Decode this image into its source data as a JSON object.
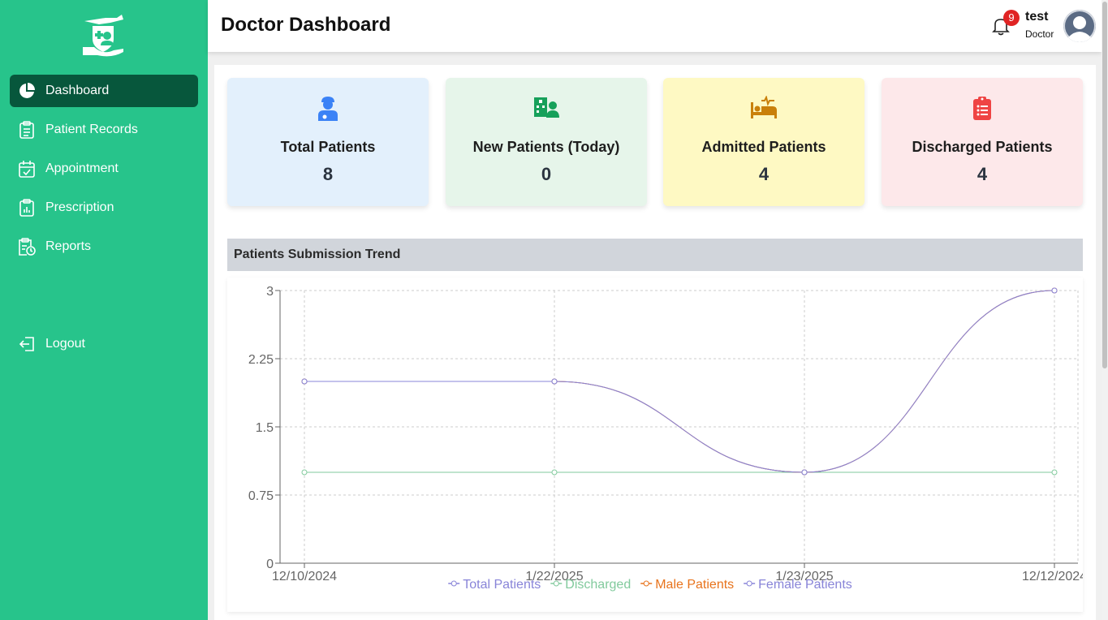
{
  "sidebar": {
    "items": [
      {
        "label": "Dashboard",
        "icon": "pie-chart-icon",
        "active": true
      },
      {
        "label": "Patient Records",
        "icon": "clipboard-list-icon",
        "active": false
      },
      {
        "label": "Appointment",
        "icon": "calendar-check-icon",
        "active": false
      },
      {
        "label": "Prescription",
        "icon": "clipboard-chart-icon",
        "active": false
      },
      {
        "label": "Reports",
        "icon": "clipboard-clock-icon",
        "active": false
      }
    ],
    "logout_label": "Logout"
  },
  "header": {
    "title": "Doctor Dashboard",
    "notification_count": "9",
    "user_name": "test",
    "user_role": "Doctor"
  },
  "cards": [
    {
      "label": "Total Patients",
      "value": "8",
      "icon": "patient-icon",
      "bg": "#e3f0fc",
      "icon_color": "#3b82f6"
    },
    {
      "label": "New Patients (Today)",
      "value": "0",
      "icon": "hospital-user-icon",
      "bg": "#e6f5ea",
      "icon_color": "#16a05a"
    },
    {
      "label": "Admitted Patients",
      "value": "4",
      "icon": "bed-icon",
      "bg": "#fef9c3",
      "icon_color": "#c9800a"
    },
    {
      "label": "Discharged Patients",
      "value": "4",
      "icon": "clipboard-list-icon",
      "bg": "#fde8ea",
      "icon_color": "#ef4444"
    }
  ],
  "section": {
    "title": "Patients Submission Trend"
  },
  "chart_data": {
    "type": "line",
    "categories": [
      "12/10/2024",
      "1/22/2025",
      "1/23/2025",
      "12/12/2024"
    ],
    "ylim": [
      0,
      3
    ],
    "yticks": [
      "0",
      "0.75",
      "1.5",
      "2.25",
      "3"
    ],
    "grid": true,
    "legend": "bottom",
    "series": [
      {
        "name": "Total Patients",
        "color": "#8884d8",
        "values": [
          2,
          2,
          1,
          3
        ]
      },
      {
        "name": "Discharged",
        "color": "#82ca9d",
        "values": [
          1,
          1,
          1,
          1
        ]
      },
      {
        "name": "Male Patients",
        "color": "#e8731c",
        "values": [
          2,
          2,
          1,
          3
        ]
      },
      {
        "name": "Female Patients",
        "color": "#8884d8",
        "values": [
          2,
          2,
          1,
          3
        ]
      }
    ]
  }
}
